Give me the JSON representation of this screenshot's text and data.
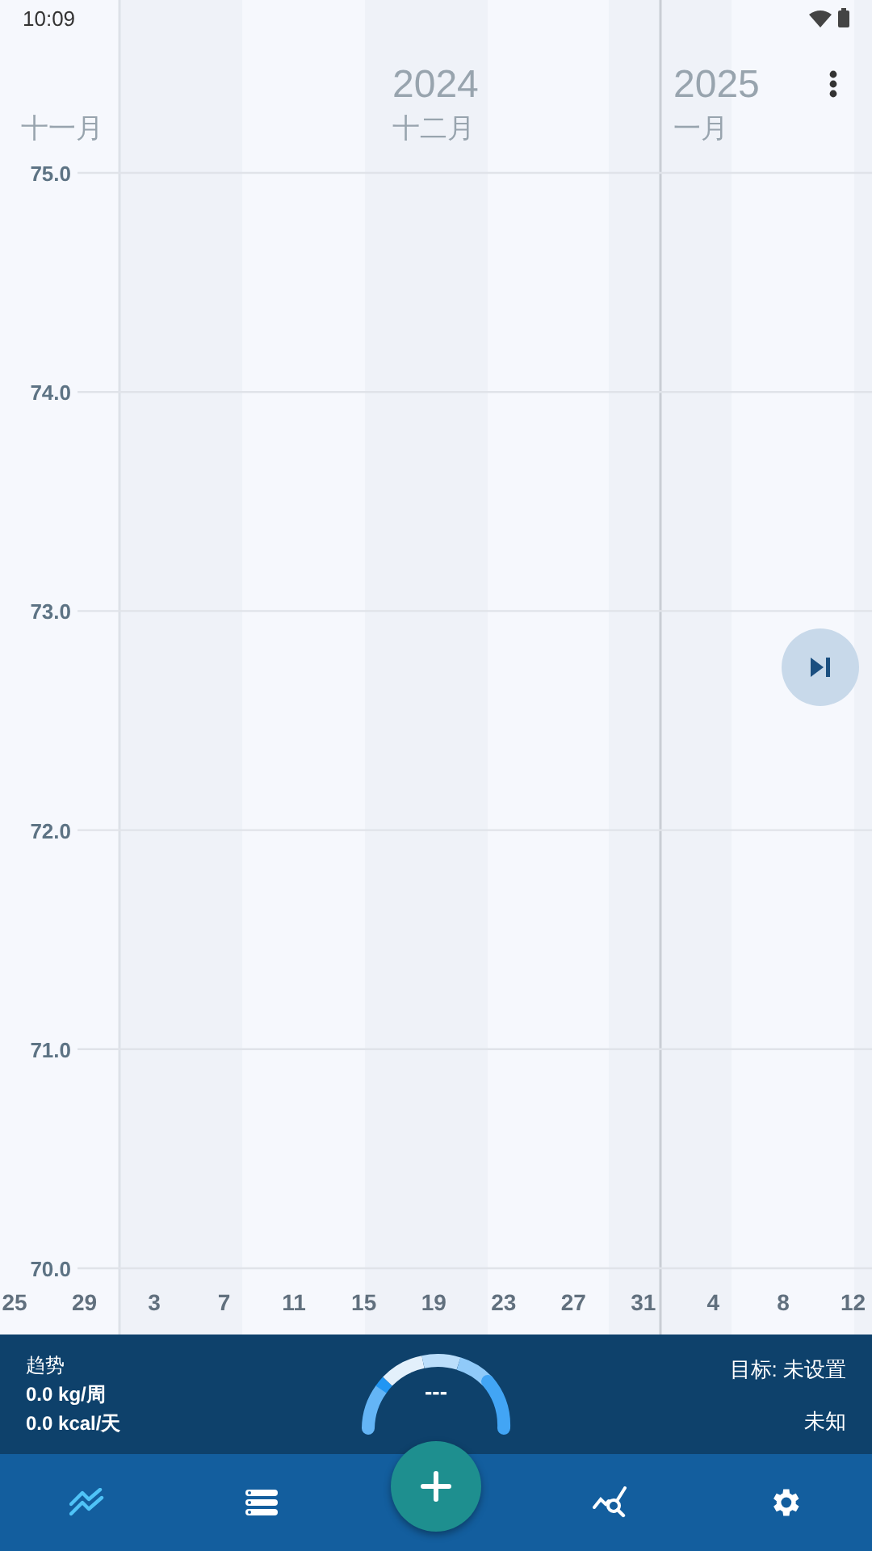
{
  "status_bar": {
    "time": "10:09"
  },
  "chart": {
    "headers": [
      {
        "month": "十一月"
      },
      {
        "year": "2024",
        "month": "十二月"
      },
      {
        "year": "2025",
        "month": "一月"
      }
    ],
    "y_labels": [
      "75.0",
      "74.0",
      "73.0",
      "72.0",
      "71.0",
      "70.0"
    ],
    "x_labels": [
      "25",
      "29",
      "3",
      "7",
      "11",
      "15",
      "19",
      "23",
      "27",
      "31",
      "4",
      "8",
      "12"
    ]
  },
  "summary": {
    "title": "趋势",
    "rate_week": "0.0 kg/周",
    "rate_day": "0.0 kcal/天",
    "gauge_value": "---",
    "goal": "目标: 未设置",
    "status": "未知"
  },
  "nav": [
    {
      "kind": "trend",
      "selected": true
    },
    {
      "kind": "list",
      "selected": false
    },
    {
      "kind": "add",
      "selected": false
    },
    {
      "kind": "analysis",
      "selected": false
    },
    {
      "kind": "settings",
      "selected": false
    }
  ]
}
